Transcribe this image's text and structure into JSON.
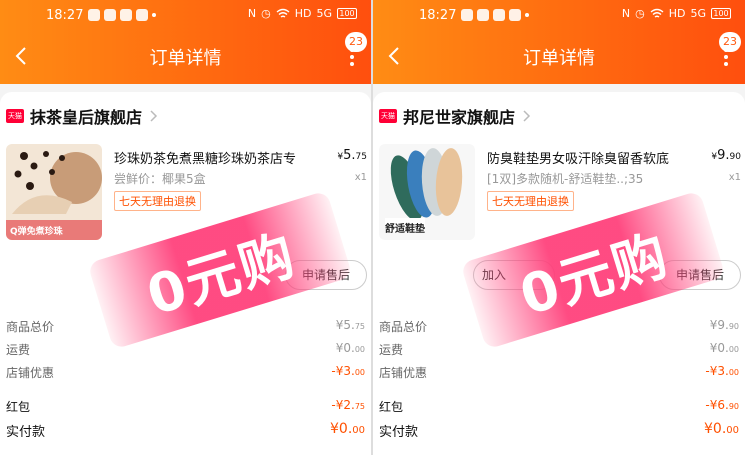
{
  "status_bar": {
    "time": "18:27",
    "hd": "HD",
    "signal": "5G",
    "battery": "100"
  },
  "badge": "23",
  "screens": [
    {
      "title": "订单详情",
      "store": {
        "badge": "天猫",
        "name": "抹茶皇后旗舰店"
      },
      "item": {
        "name": "珍珠奶茶免煮黑糖珍珠奶茶店专",
        "sku": "尝鲜价：椰果5盒",
        "tag": "七天无理由退换",
        "price_cur": "¥",
        "price_int": "5.",
        "price_dec": "75",
        "qty": "x1",
        "image_text": "Q弹免煮珍珠"
      },
      "buttons": {
        "after_sale": "申请售后"
      },
      "summary": [
        {
          "label": "商品总价",
          "int": "¥5.",
          "dec": "75"
        },
        {
          "label": "运费",
          "int": "¥0.",
          "dec": "00"
        },
        {
          "label": "店铺优惠",
          "int": "-¥3.",
          "dec": "00"
        }
      ],
      "redpacket": {
        "label": "红包",
        "int": "-¥2.",
        "dec": "75"
      },
      "paid": {
        "label": "实付款",
        "int": "¥0.",
        "dec": "00"
      },
      "stamp": "0元购"
    },
    {
      "title": "订单详情",
      "store": {
        "badge": "天猫",
        "name": "邦尼世家旗舰店"
      },
      "item": {
        "name": "防臭鞋垫男女吸汗除臭留香软底",
        "sku": "[1双]多款随机-舒适鞋垫..;35",
        "tag": "七天无理由退换",
        "price_cur": "¥",
        "price_int": "9.",
        "price_dec": "90",
        "qty": "x1",
        "image_text": "舒适鞋垫"
      },
      "buttons": {
        "add_cart": "加入",
        "after_sale": "申请售后"
      },
      "summary": [
        {
          "label": "商品总价",
          "int": "¥9.",
          "dec": "90"
        },
        {
          "label": "运费",
          "int": "¥0.",
          "dec": "00"
        },
        {
          "label": "店铺优惠",
          "int": "-¥3.",
          "dec": "00"
        }
      ],
      "redpacket": {
        "label": "红包",
        "int": "-¥6.",
        "dec": "90"
      },
      "paid": {
        "label": "实付款",
        "int": "¥0.",
        "dec": "00"
      },
      "stamp": "0元购"
    }
  ],
  "colors": {
    "header_start": "#ff8c14",
    "header_end": "#ff4f0e",
    "accent": "#ff5000",
    "stamp": "#ff3c78"
  }
}
